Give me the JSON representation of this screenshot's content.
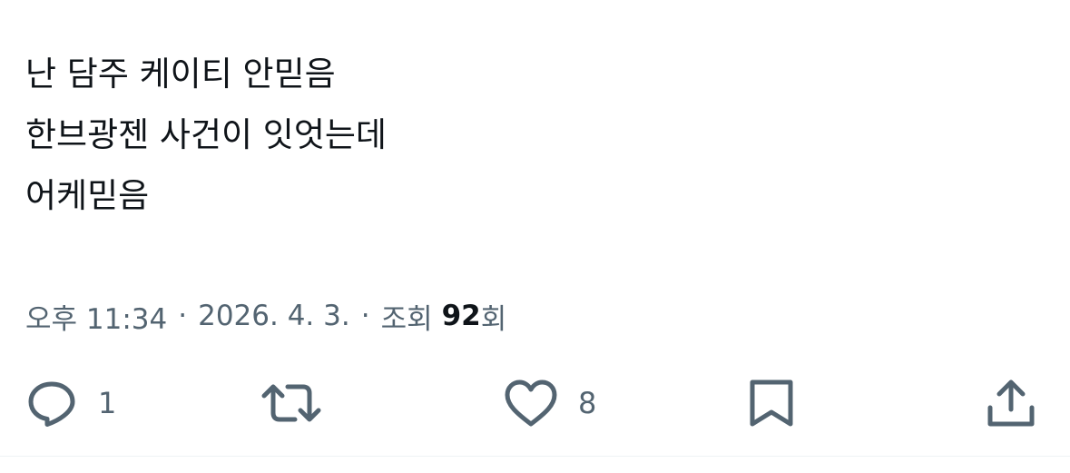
{
  "tweet": {
    "lines": [
      "난 담주 케이티 안믿음",
      "한브광젠 사건이 잇엇는데",
      "어케믿음"
    ]
  },
  "meta": {
    "time": "오후 11:34",
    "separator": "·",
    "date": "2026. 4. 3.",
    "views_label": "조회",
    "views_count": "92",
    "views_suffix": "회"
  },
  "actions": {
    "reply": {
      "icon": "reply-icon",
      "count": "1"
    },
    "retweet": {
      "icon": "retweet-icon"
    },
    "like": {
      "icon": "heart-icon",
      "count": "8"
    },
    "bookmark": {
      "icon": "bookmark-icon"
    },
    "share": {
      "icon": "share-icon"
    }
  },
  "colors": {
    "text": "#0f1419",
    "secondary": "#536471",
    "divider": "#eff3f4"
  }
}
